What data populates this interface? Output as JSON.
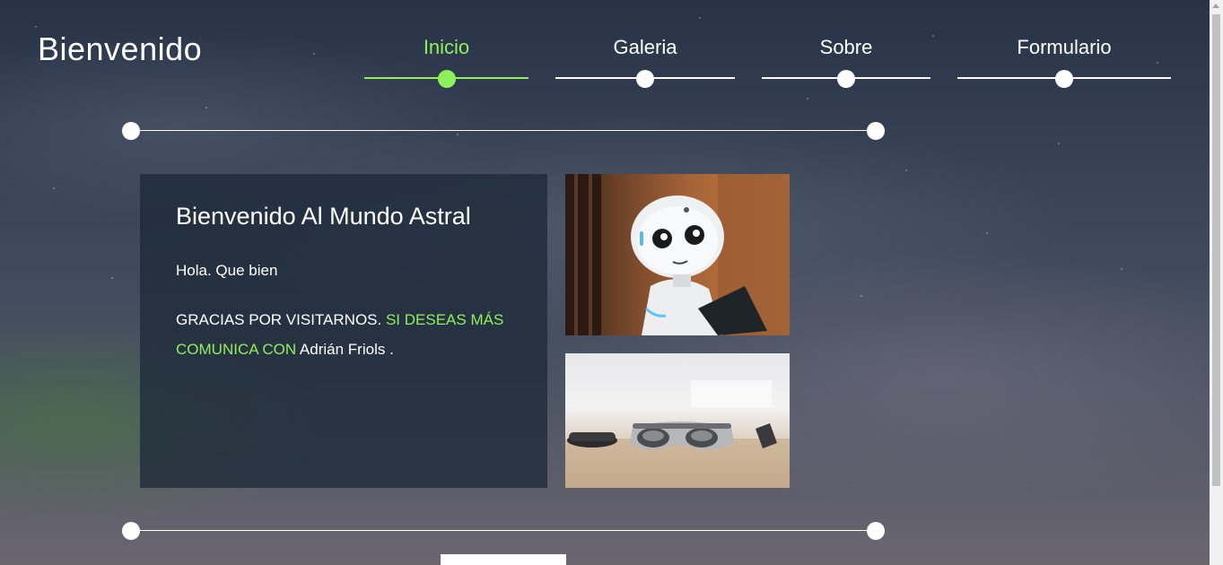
{
  "header": {
    "brand": "Bienvenido"
  },
  "nav": {
    "items": [
      {
        "label": "Inicio",
        "active": true
      },
      {
        "label": "Galeria",
        "active": false
      },
      {
        "label": "Sobre",
        "active": false
      },
      {
        "label": "Formulario",
        "active": false
      }
    ]
  },
  "main": {
    "title": "Bienvenido Al Mundo Astral",
    "greeting": "Hola. Que bien",
    "message_part1": "GRACIAS POR VISITARNOS.",
    "message_accent": "SI DESEAS MÁS COMUNICA CON",
    "message_name": "Adrián Friols ."
  },
  "colors": {
    "accent": "#8ef05a",
    "panel": "#1e2a3a"
  },
  "images": [
    {
      "name": "robot-photo"
    },
    {
      "name": "ar-glasses-photo"
    }
  ]
}
